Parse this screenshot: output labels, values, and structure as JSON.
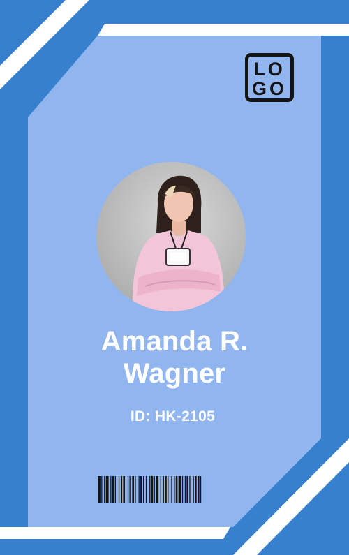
{
  "badge": {
    "logo_lines": [
      "LO",
      "GO"
    ],
    "name_lines": [
      "Amanda R.",
      "Wagner"
    ],
    "id_text": "ID: HK-2105"
  },
  "colors": {
    "frame_blue": "#3780cd",
    "panel_blue": "#91b5ee",
    "white": "#ffffff",
    "ink": "#141414"
  },
  "icons": {
    "logo": "logo-box-icon",
    "photo": "portrait-photo",
    "barcode": "barcode-icon"
  }
}
